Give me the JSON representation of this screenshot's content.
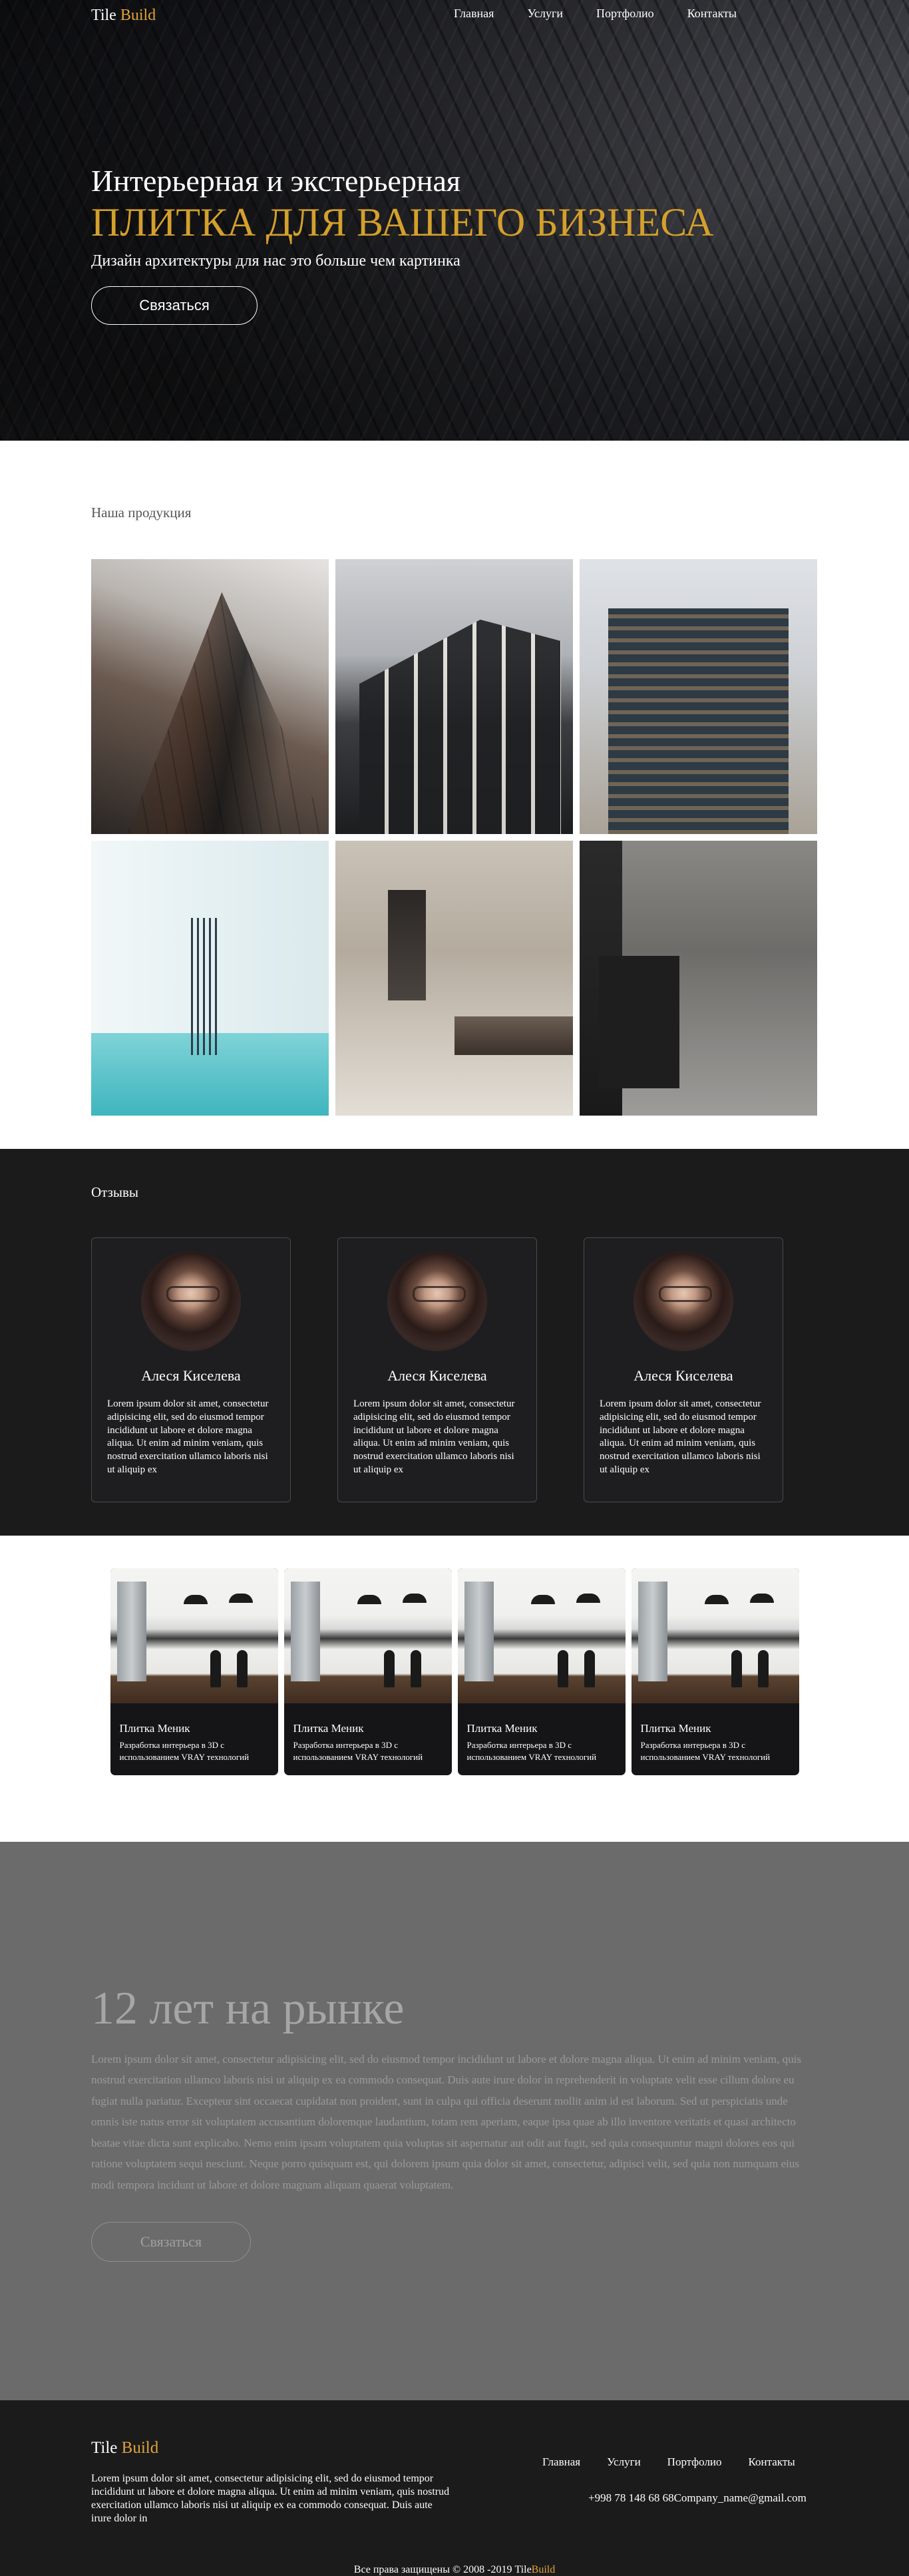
{
  "header": {
    "logo_main": "Tile",
    "logo_accent": "Build",
    "nav": [
      "Главная",
      "Услуги",
      "Портфолио",
      "Контакты"
    ]
  },
  "hero": {
    "title": "Интерьерная и экстерьерная",
    "subtitle": "ПЛИТКА ДЛЯ ВАШЕГО БИЗНЕСА",
    "lead": "Дизайн архитектуры для нас это больше чем картинка",
    "button": "Связаться",
    "accent_color": "#d4a02c"
  },
  "products": {
    "title": "Наша продукция"
  },
  "reviews": {
    "title": "Отзывы",
    "items": [
      {
        "name": "Алеся Киселева",
        "text": "Lorem ipsum dolor sit amet, consectetur adipisicing elit, sed do eiusmod tempor incididunt ut labore et dolore magna aliqua. Ut enim ad minim veniam, quis nostrud exercitation ullamco laboris nisi ut aliquip ex"
      },
      {
        "name": "Алеся Киселева",
        "text": "Lorem ipsum dolor sit amet, consectetur adipisicing elit, sed do eiusmod tempor incididunt ut labore et dolore magna aliqua. Ut enim ad minim veniam, quis nostrud exercitation ullamco laboris nisi ut aliquip ex"
      },
      {
        "name": "Алеся Киселева",
        "text": "Lorem ipsum dolor sit amet, consectetur adipisicing elit, sed do eiusmod tempor incididunt ut labore et dolore magna aliqua. Ut enim ad minim veniam, quis nostrud exercitation ullamco laboris nisi ut aliquip ex"
      }
    ]
  },
  "kitchens": [
    {
      "title": "Плитка Меник",
      "text": "Разработка интерьера в 3D с использованием VRAY технологий"
    },
    {
      "title": "Плитка Меник",
      "text": "Разработка интерьера в 3D с использованием VRAY технологий"
    },
    {
      "title": "Плитка Меник",
      "text": "Разработка интерьера в 3D с использованием VRAY технологий"
    },
    {
      "title": "Плитка Меник",
      "text": "Разработка интерьера в 3D с использованием VRAY технологий"
    }
  ],
  "years": {
    "title": "12 лет на рынке",
    "text": "Lorem ipsum dolor sit amet, consectetur adipisicing elit, sed do eiusmod tempor incididunt ut labore et dolore magna aliqua. Ut enim ad minim veniam, quis nostrud exercitation ullamco laboris nisi ut aliquip ex ea commodo consequat. Duis aute irure dolor in reprehenderit in voluptate velit esse cillum dolore eu fugiat nulla pariatur. Excepteur sint occaecat cupidatat non proident, sunt in culpa qui officia deserunt mollit anim id est laborum. Sed ut perspiciatis unde omnis iste natus error sit voluptatem accusantium doloremque laudantium, totam rem aperiam, eaque ipsa quae ab illo inventore veritatis et quasi architecto beatae vitae dicta sunt explicabo. Nemo enim ipsam voluptatem quia voluptas sit aspernatur aut odit aut fugit, sed quia consequuntur magni dolores eos qui ratione voluptatem sequi nesciunt. Neque porro quisquam est, qui dolorem ipsum quia dolor sit amet, consectetur, adipisci velit, sed quia non numquam eius modi tempora incidunt ut labore et dolore magnam aliquam quaerat voluptatem.",
    "button": "Связаться"
  },
  "footer": {
    "logo_main": "Tile",
    "logo_accent": "Build",
    "text": "Lorem ipsum dolor sit amet, consectetur adipisicing elit, sed do eiusmod tempor incididunt ut labore et dolore magna aliqua. Ut enim ad minim veniam, quis nostrud exercitation ullamco laboris nisi ut aliquip ex ea commodo consequat. Duis aute irure dolor in",
    "nav": [
      "Главная",
      "Услуги",
      "Портфолио",
      "Контакты"
    ],
    "contact": "+998 78 148 68 68Company_name@gmail.com",
    "copyright": "Все права защищены © 2008 -2019 Tile",
    "copyright_accent": "Build"
  }
}
